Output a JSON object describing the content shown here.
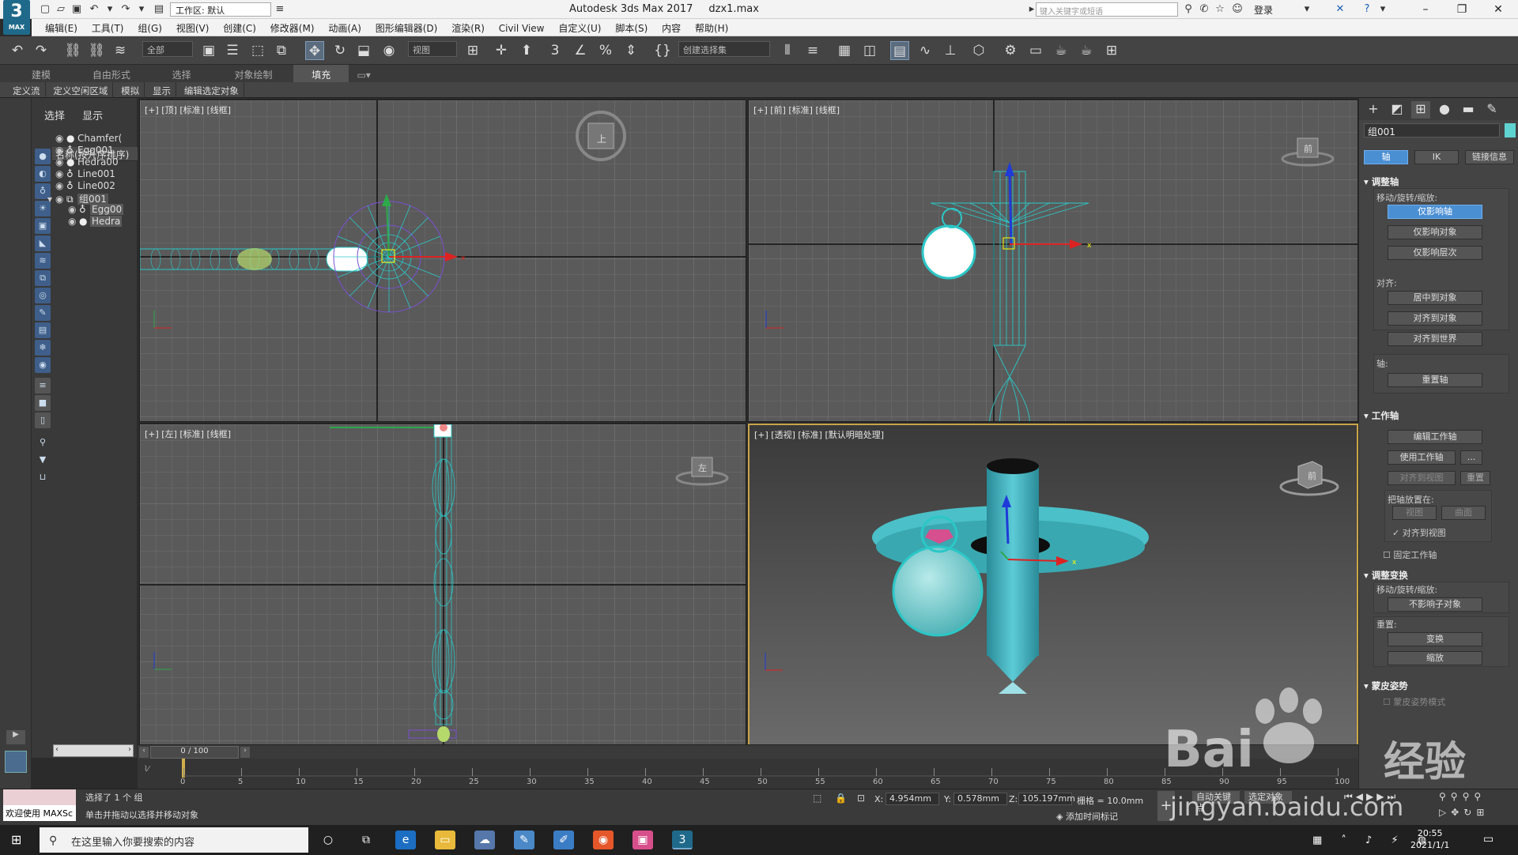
{
  "app": {
    "title": "Autodesk 3ds Max 2017",
    "file": "dzx1.max",
    "logo_text": "3",
    "logo_sub": "MAX",
    "workspace": "工作区: 默认",
    "search_placeholder": "键入关键字或短语",
    "login": "登录"
  },
  "menu": [
    "编辑(E)",
    "工具(T)",
    "组(G)",
    "视图(V)",
    "创建(C)",
    "修改器(M)",
    "动画(A)",
    "图形编辑器(D)",
    "渲染(R)",
    "Civil View",
    "自定义(U)",
    "脚本(S)",
    "内容",
    "帮助(H)"
  ],
  "toolbar": {
    "filter": "全部",
    "refcoord": "视图",
    "selset": "创建选择集"
  },
  "ribbon_tabs": [
    "建模",
    "自由形式",
    "选择",
    "对象绘制",
    "填充"
  ],
  "ribbon_row2": [
    "定义流",
    "定义空闲区域",
    "模拟",
    "显示",
    "编辑选定对象"
  ],
  "explorer": {
    "tabs": [
      "选择",
      "显示"
    ],
    "header": "名称(按升序排序)",
    "items": [
      {
        "name": "Chamfer("
      },
      {
        "name": "Egg001"
      },
      {
        "name": "Hedra00"
      },
      {
        "name": "Line001"
      },
      {
        "name": "Line002"
      },
      {
        "name": "组001"
      },
      {
        "name": "Egg00"
      },
      {
        "name": "Hedra"
      }
    ]
  },
  "viewports": {
    "top": "[+] [顶] [标准] [线框]",
    "front": "[+] [前] [标准] [线框]",
    "left": "[+] [左] [标准] [线框]",
    "persp": "[+] [透视] [标准] [默认明暗处理]",
    "cube_top": "上",
    "cube_front": "前",
    "cube_left": "左",
    "cube_persp": "前"
  },
  "command_panel": {
    "object_name": "组001",
    "color": "#5fd3cf",
    "tabs_hier": [
      "轴",
      "IK",
      "链接信息"
    ],
    "sec_adjust_pivot": "调整轴",
    "move_rotate_scale": "移动/旋转/缩放:",
    "btn_affect_pivot": "仅影响轴",
    "btn_affect_object": "仅影响对象",
    "btn_affect_hierarchy": "仅影响层次",
    "align": "对齐:",
    "btn_center": "居中到对象",
    "btn_align_obj": "对齐到对象",
    "btn_align_world": "对齐到世界",
    "pivot": "轴:",
    "btn_reset": "重置轴",
    "sec_working_pivot": "工作轴",
    "btn_edit_wp": "编辑工作轴",
    "btn_use_wp": "使用工作轴",
    "btn_align_view": "对齐到视图",
    "btn_reset2": "重置",
    "place_pivot": "把轴放置在:",
    "btn_view": "视图",
    "btn_surface": "曲面",
    "chk_align_view": "对齐到视图",
    "chk_fixed": "固定工作轴",
    "sec_adjust_transform": "调整变换",
    "mrs2": "移动/旋转/缩放:",
    "btn_dont_affect": "不影响子对象",
    "reset": "重置:",
    "btn_transform": "变换",
    "btn_scale": "缩放",
    "sec_skin": "蒙皮姿势",
    "skin_mode": "蒙皮姿势模式"
  },
  "timeline": {
    "frame": "0 / 100",
    "ticks": [
      "0",
      "5",
      "10",
      "15",
      "20",
      "25",
      "30",
      "35",
      "40",
      "45",
      "50",
      "55",
      "60",
      "65",
      "70",
      "75",
      "80",
      "85",
      "90",
      "95",
      "100"
    ]
  },
  "status": {
    "welcome": "欢迎使用 MAXSc",
    "selected": "选择了 1 个 组",
    "hint": "单击并拖动以选择并移动对象",
    "x_label": "X:",
    "x": "4.954mm",
    "y_label": "Y:",
    "y": "0.578mm",
    "z_label": "Z:",
    "z": "105.197mm",
    "grid": "栅格 = 10.0mm",
    "add_tag": "添加时间标记",
    "auto_key": "自动关键点",
    "sel_obj": "选定对象"
  },
  "taskbar": {
    "search": "在这里输入你要搜索的内容",
    "time": "20:55",
    "date": "2021/1/1"
  },
  "watermark": {
    "brand": "Bai",
    "brand2": "经验",
    "url": "jingyan.baidu.com"
  }
}
